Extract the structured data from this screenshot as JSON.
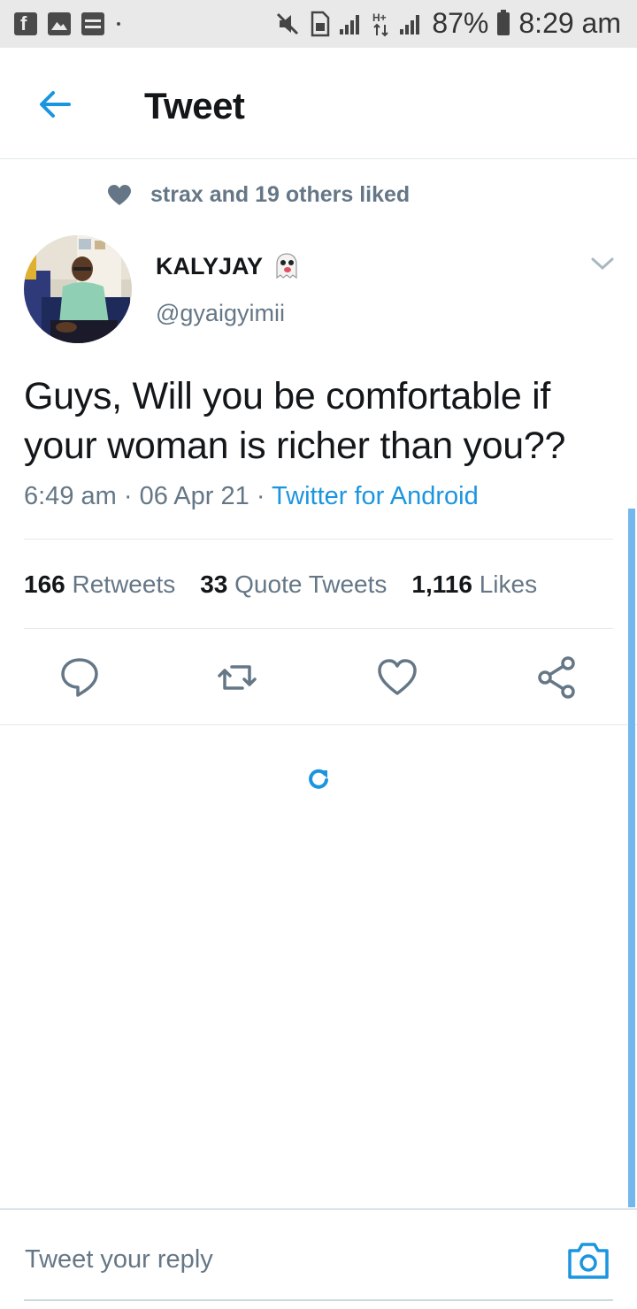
{
  "status_bar": {
    "battery": "87%",
    "time": "8:29 am",
    "icons": [
      "facebook-icon",
      "gallery-icon",
      "card-icon",
      "mute-icon",
      "sim-icon",
      "signal-icon",
      "hplus-icon",
      "battery-icon"
    ]
  },
  "header": {
    "title": "Tweet"
  },
  "social_context": {
    "text": "strax and 19 others liked"
  },
  "author": {
    "name": "KALYJAY",
    "emoji": "👻",
    "handle": "@gyaigyimii"
  },
  "tweet": {
    "text": "Guys, Will you be comfortable if your woman is richer than you??",
    "time": "6:49 am",
    "sep1": "·",
    "date": "06 Apr 21",
    "sep2": "·",
    "source": "Twitter for Android"
  },
  "stats": {
    "retweets_count": "166",
    "retweets_label": "Retweets",
    "quotes_count": "33",
    "quotes_label": "Quote Tweets",
    "likes_count": "1,116",
    "likes_label": "Likes"
  },
  "reply_bar": {
    "placeholder": "Tweet your reply"
  },
  "colors": {
    "accent": "#1b95e0",
    "secondary_text": "#657786",
    "border": "#e1e8ed"
  }
}
